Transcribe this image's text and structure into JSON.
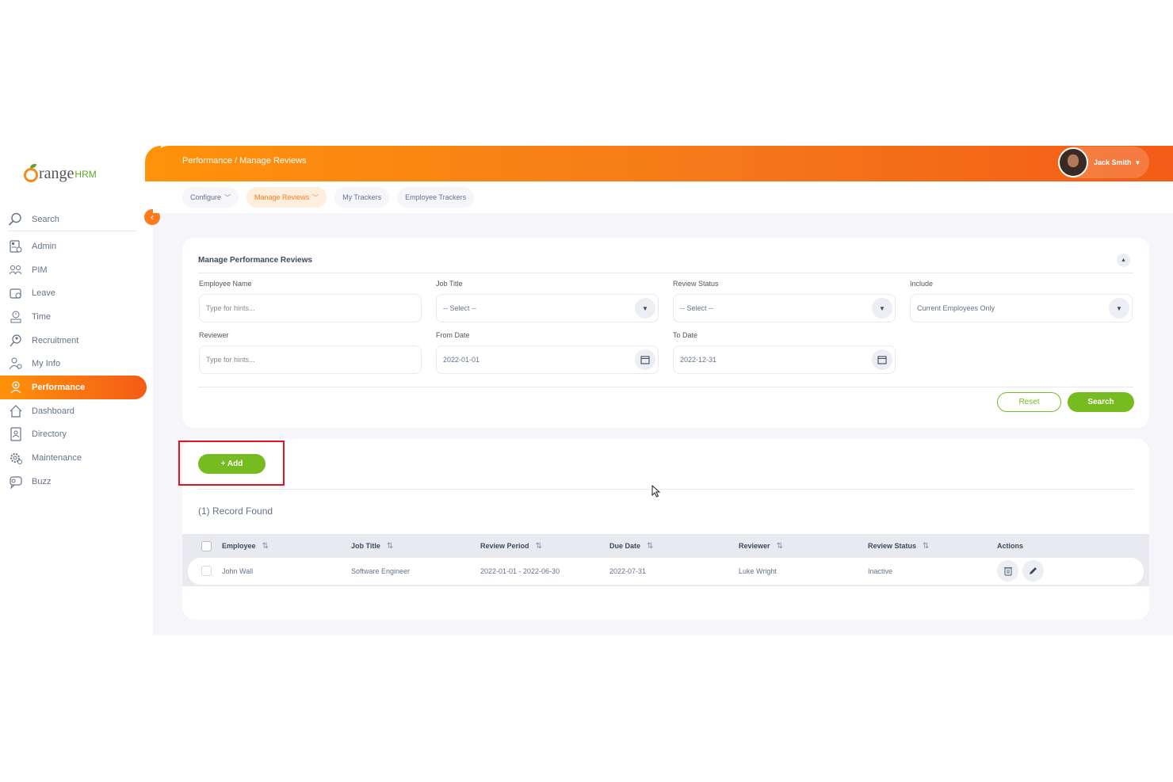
{
  "brand": {
    "logo_text": "range",
    "logo_suffix": "HRM",
    "accent": "#ff7b1d",
    "green": "#76bc21"
  },
  "sidebar": {
    "search_label": "Search",
    "items": [
      {
        "label": "Admin",
        "icon": "admin-icon"
      },
      {
        "label": "PIM",
        "icon": "pim-icon"
      },
      {
        "label": "Leave",
        "icon": "leave-icon"
      },
      {
        "label": "Time",
        "icon": "time-icon"
      },
      {
        "label": "Recruitment",
        "icon": "recruitment-icon"
      },
      {
        "label": "My Info",
        "icon": "my-info-icon"
      },
      {
        "label": "Performance",
        "icon": "performance-icon",
        "active": true
      },
      {
        "label": "Dashboard",
        "icon": "dashboard-icon"
      },
      {
        "label": "Directory",
        "icon": "directory-icon"
      },
      {
        "label": "Maintenance",
        "icon": "maintenance-icon"
      },
      {
        "label": "Buzz",
        "icon": "buzz-icon"
      }
    ]
  },
  "header": {
    "breadcrumb": "Performance / Manage Reviews",
    "user_name": "Jack Smith"
  },
  "tabs": [
    {
      "label": "Configure",
      "has_menu": true
    },
    {
      "label": "Manage Reviews",
      "has_menu": true,
      "active": true
    },
    {
      "label": "My Trackers",
      "has_menu": false
    },
    {
      "label": "Employee Trackers",
      "has_menu": false
    }
  ],
  "filter": {
    "title": "Manage Performance Reviews",
    "employee_name": {
      "label": "Employee Name",
      "placeholder": "Type for hints..."
    },
    "job_title": {
      "label": "Job Title",
      "value": "-- Select --"
    },
    "review_status": {
      "label": "Review Status",
      "value": "-- Select --"
    },
    "include": {
      "label": "Include",
      "value": "Current Employees Only"
    },
    "reviewer": {
      "label": "Reviewer",
      "placeholder": "Type for hints..."
    },
    "from_date": {
      "label": "From Date",
      "value": "2022-01-01"
    },
    "to_date": {
      "label": "To Date",
      "value": "2022-12-31"
    },
    "reset_label": "Reset",
    "search_label": "Search"
  },
  "results": {
    "add_label": "+ Add",
    "record_text": "(1) Record Found",
    "columns": [
      "Employee",
      "Job Title",
      "Review Period",
      "Due Date",
      "Reviewer",
      "Review Status",
      "Actions"
    ],
    "rows": [
      {
        "employee": "John Wall",
        "job_title": "Software Engineer",
        "review_period": "2022-01-01 - 2022-06-30",
        "due_date": "2022-07-31",
        "reviewer": "Luke Wright",
        "review_status": "Inactive"
      }
    ]
  }
}
